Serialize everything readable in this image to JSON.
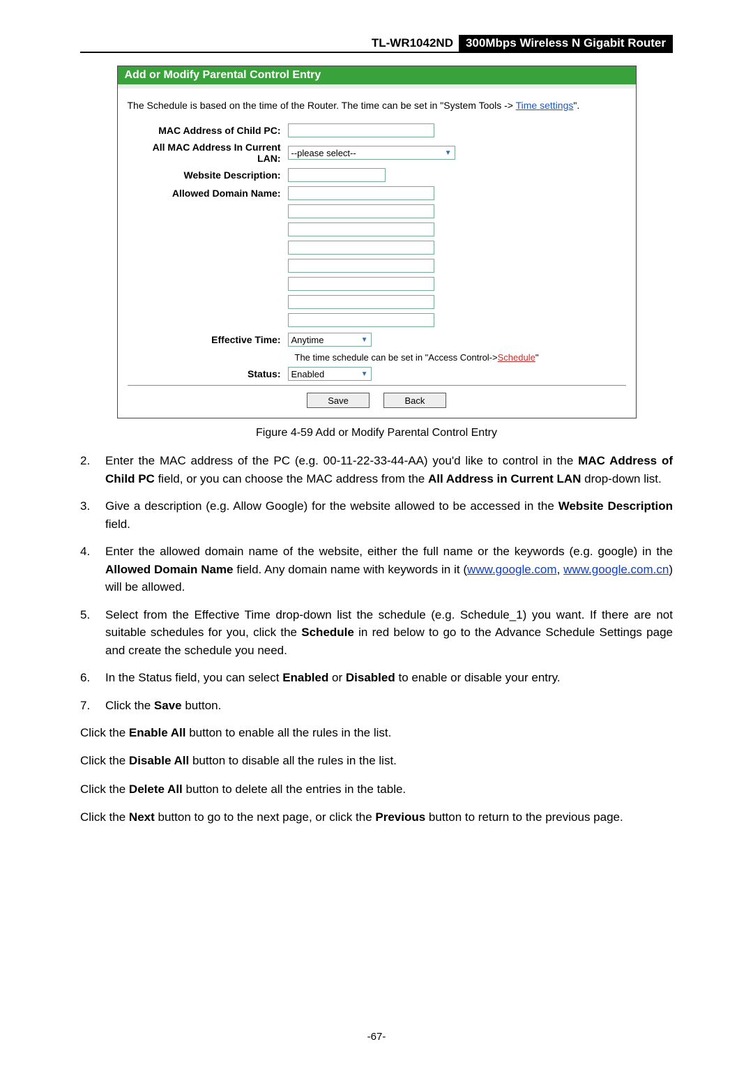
{
  "header": {
    "model": "TL-WR1042ND",
    "product": "300Mbps Wireless N Gigabit Router"
  },
  "screenshot": {
    "title": "Add or Modify Parental Control Entry",
    "note_pre": "The Schedule is based on the time of the Router. The time can be set in \"System Tools -> ",
    "note_link": "Time settings",
    "note_post": "\".",
    "labels": {
      "mac_child": "MAC Address of Child PC:",
      "all_mac": "All MAC Address In Current LAN:",
      "website_desc": "Website Description:",
      "allowed_domain": "Allowed Domain Name:",
      "effective_time": "Effective Time:",
      "status": "Status:"
    },
    "placeholders": {
      "all_mac": "--please select--"
    },
    "effective_time_value": "Anytime",
    "hint_pre": "The time schedule can be set in \"Access Control->",
    "hint_link": "Schedule",
    "hint_post": "\"",
    "status_value": "Enabled",
    "buttons": {
      "save": "Save",
      "back": "Back"
    }
  },
  "figure_caption": "Figure 4-59    Add or Modify Parental Control Entry",
  "steps": {
    "s2_a": "Enter the MAC address of the PC (e.g. 00-11-22-33-44-AA) you'd like to control in the ",
    "s2_b": "MAC Address of Child PC",
    "s2_c": " field, or you can choose the MAC address from the ",
    "s2_d": "All Address in Current LAN",
    "s2_e": " drop-down list.",
    "s3_a": "Give a description (e.g. Allow Google) for the website allowed to be accessed in the ",
    "s3_b": "Website Description",
    "s3_c": " field.",
    "s4_a": "Enter the allowed domain name of the website, either the full name or the keywords (e.g. google) in the ",
    "s4_b": "Allowed Domain Name",
    "s4_c": " field. Any domain name with keywords in it (",
    "s4_link1": "www.google.com",
    "s4_d": ", ",
    "s4_link2": "www.google.com.cn",
    "s4_e": ") will be allowed.",
    "s5_a": "Select from the Effective Time drop-down list the schedule (e.g. Schedule_1) you want. If there are not suitable schedules for you, click the ",
    "s5_b": "Schedule",
    "s5_c": " in red below to go to the Advance Schedule Settings page and create the schedule you need.",
    "s6_a": "In the Status field, you can select ",
    "s6_b": "Enabled",
    "s6_c": " or ",
    "s6_d": "Disabled",
    "s6_e": " to enable or disable your entry.",
    "s7_a": "Click the ",
    "s7_b": "Save",
    "s7_c": " button."
  },
  "paras": {
    "p1_a": "Click the ",
    "p1_b": "Enable All",
    "p1_c": " button to enable all the rules in the list.",
    "p2_a": "Click the ",
    "p2_b": "Disable All",
    "p2_c": " button to disable all the rules in the list.",
    "p3_a": "Click the ",
    "p3_b": "Delete All",
    "p3_c": " button to delete all the entries in the table.",
    "p4_a": "Click the ",
    "p4_b": "Next",
    "p4_c": " button to go to the next page, or click the ",
    "p4_d": "Previous",
    "p4_e": " button to return to the previous page."
  },
  "page_number": "-67-"
}
